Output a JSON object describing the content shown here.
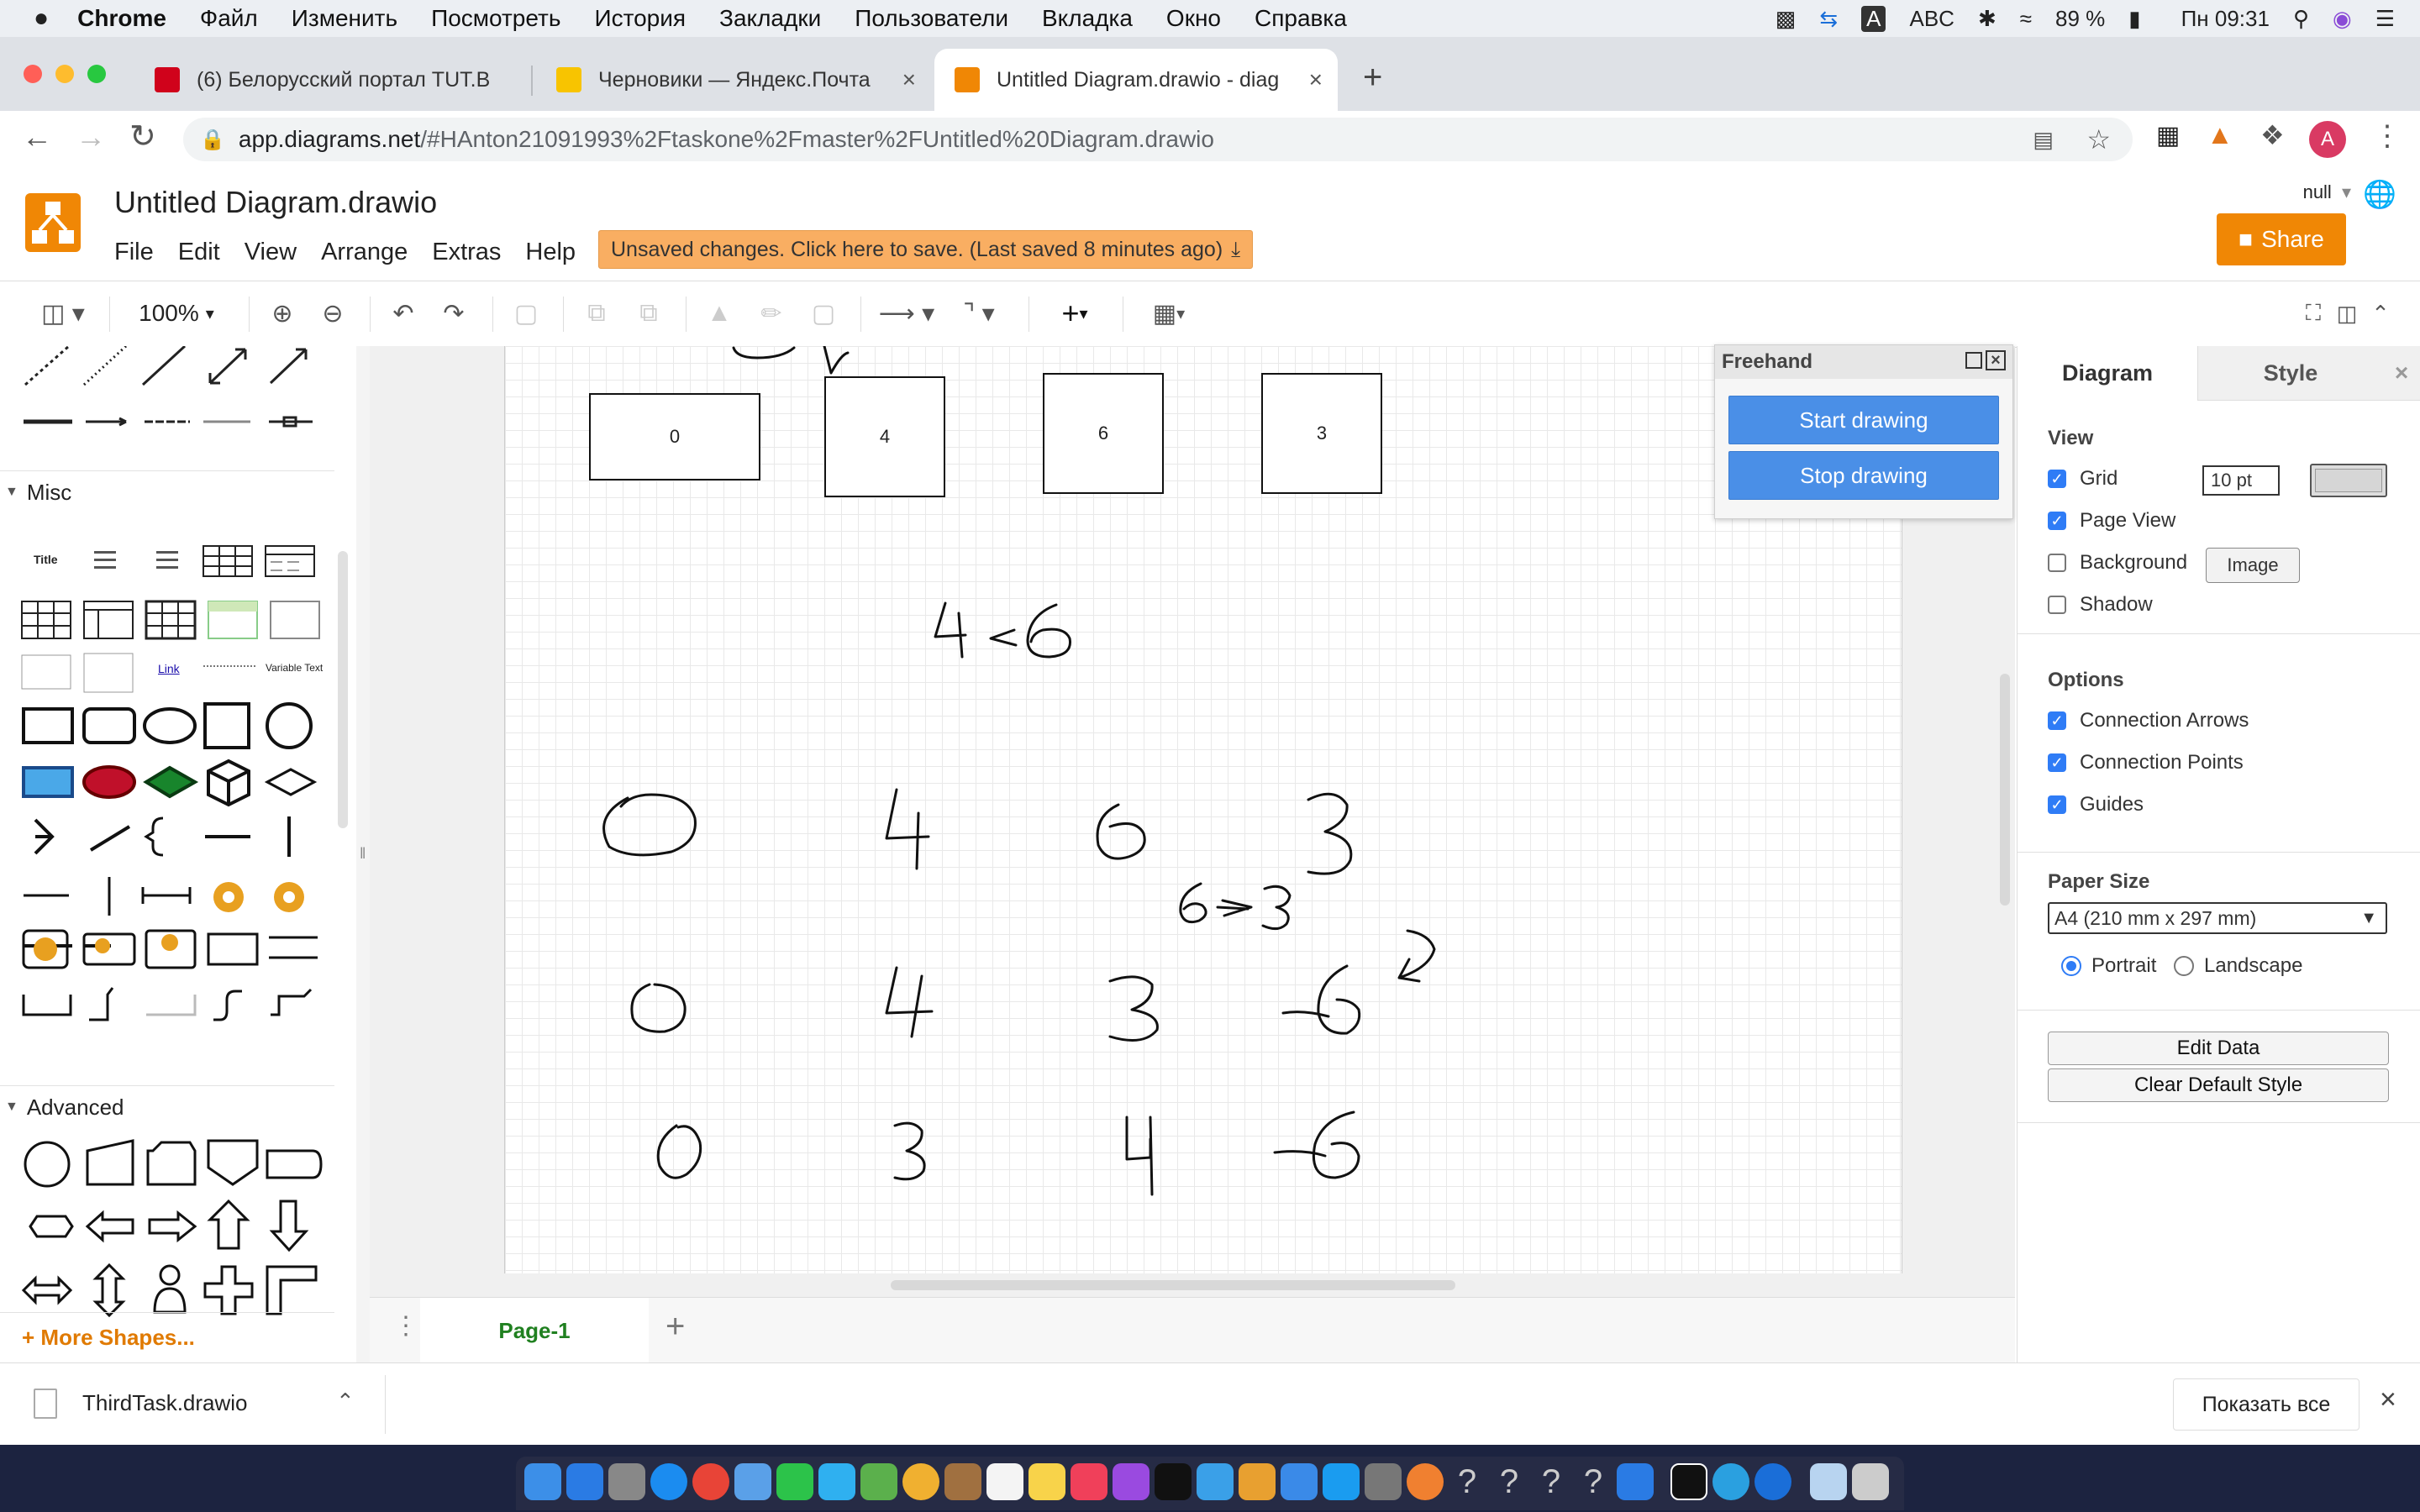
{
  "menubar": {
    "apple": "",
    "app_name": "Chrome",
    "items": [
      "Файл",
      "Изменить",
      "Посмотреть",
      "История",
      "Закладки",
      "Пользователи",
      "Вкладка",
      "Окно",
      "Справка"
    ],
    "input_lang": "A",
    "input_method": "ABC",
    "battery": "89 %",
    "clock": "Пн 09:31"
  },
  "browser": {
    "tabs": [
      {
        "title": "(6) Белорусский портал TUT.B",
        "favicon_color": "#d0021b"
      },
      {
        "title": "Черновики — Яндекс.Почта",
        "favicon_color": "#f8c400"
      },
      {
        "title": "Untitled Diagram.drawio - diag",
        "favicon_color": "#f08705"
      }
    ],
    "new_tab": "+",
    "close_glyph": "×",
    "url_host": "app.diagrams.net",
    "url_path": "/#HAnton21091993%2Ftaskone%2Fmaster%2FUntitled%20Diagram.drawio",
    "profile_initial": "A"
  },
  "drawio": {
    "doc_title": "Untitled Diagram.drawio",
    "menu": [
      "File",
      "Edit",
      "View",
      "Arrange",
      "Extras",
      "Help"
    ],
    "unsaved_notice": "Unsaved changes. Click here to save. (Last saved 8 minutes ago)",
    "share_label": "Share",
    "user_label": "null",
    "zoom": "100%",
    "left_sections": {
      "misc": "Misc",
      "advanced": "Advanced",
      "more_shapes": "+ More Shapes..."
    },
    "misc_thumbs": {
      "title": "Title",
      "link": "Link",
      "variable_text": "Variable Text"
    },
    "page_tab": "Page-1",
    "add_page": "+",
    "page_menu": "⋮"
  },
  "canvas": {
    "boxes": [
      {
        "label": "0"
      },
      {
        "label": "4"
      },
      {
        "label": "6"
      },
      {
        "label": "3"
      }
    ],
    "freehand_notes": [
      "4 < 6",
      "0  4  6  3",
      "6 > 3",
      "0  4  3  6",
      "0  3  4  6"
    ]
  },
  "freehand_dialog": {
    "title": "Freehand",
    "start_label": "Start drawing",
    "stop_label": "Stop drawing"
  },
  "format_panel": {
    "tabs": [
      "Diagram",
      "Style"
    ],
    "view_heading": "View",
    "grid_label": "Grid",
    "grid_size": "10 pt",
    "page_view_label": "Page View",
    "background_label": "Background",
    "image_button": "Image",
    "shadow_label": "Shadow",
    "options_heading": "Options",
    "connection_arrows": "Connection Arrows",
    "connection_points": "Connection Points",
    "guides": "Guides",
    "paper_size_heading": "Paper Size",
    "paper_size_value": "A4 (210 mm x 297 mm)",
    "portrait": "Portrait",
    "landscape": "Landscape",
    "edit_data": "Edit Data",
    "clear_default_style": "Clear Default Style",
    "checks": {
      "grid": true,
      "page_view": true,
      "background": false,
      "shadow": false,
      "connection_arrows": true,
      "connection_points": true,
      "guides": true
    },
    "orientation": "portrait"
  },
  "download_shelf": {
    "file_name": "ThirdTask.drawio",
    "show_all": "Показать все"
  }
}
